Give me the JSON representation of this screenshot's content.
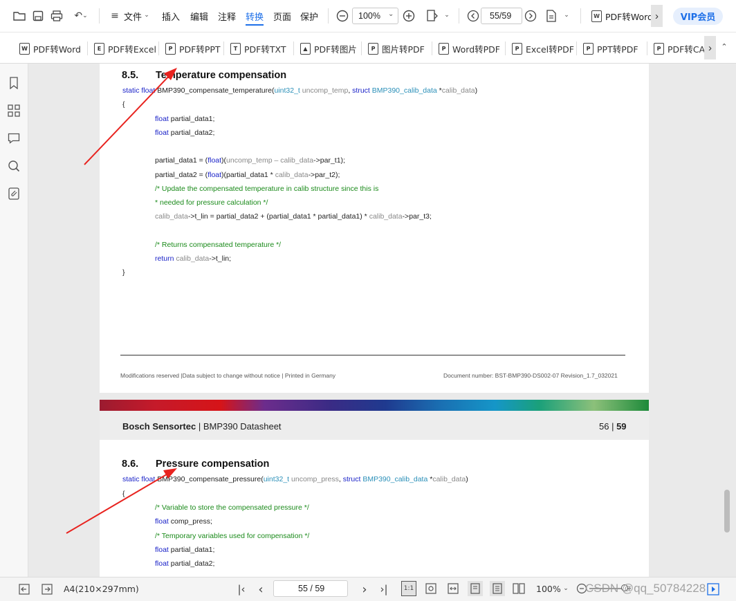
{
  "toolbar": {
    "menu": [
      "文件",
      "插入",
      "编辑",
      "注释",
      "转换",
      "页面",
      "保护"
    ],
    "active_menu": "转换",
    "zoom": "100%",
    "page_field": "55/59",
    "pdf_to_word_top": "PDF转Word",
    "vip": "VIP会员"
  },
  "convert_bar": [
    {
      "label": "PDF转Word",
      "icon": "W"
    },
    {
      "label": "PDF转Excel",
      "icon": "E"
    },
    {
      "label": "PDF转PPT",
      "icon": "P"
    },
    {
      "label": "PDF转TXT",
      "icon": "T"
    },
    {
      "label": "PDF转图片",
      "icon": "▲"
    },
    {
      "label": "图片转PDF",
      "icon": "P"
    },
    {
      "label": "Word转PDF",
      "icon": "P"
    },
    {
      "label": "Excel转PDF",
      "icon": "P"
    },
    {
      "label": "PPT转PDF",
      "icon": "P"
    },
    {
      "label": "PDF转CA",
      "icon": "P"
    }
  ],
  "page55": {
    "section_num": "8.5.",
    "section_title": "Temperature compensation",
    "code": {
      "sig_static": "static float ",
      "sig_name": "BMP390_compensate_temperature(",
      "sig_t1": "uint32_t ",
      "sig_a1": "uncomp_temp",
      "sig_c": ", ",
      "sig_struct": "struct ",
      "sig_t2": "BMP390_calib_data ",
      "sig_star": "*",
      "sig_a2": "calib_data",
      "sig_end": ")",
      "open": "{",
      "l1_kw": "float ",
      "l1": "partial_data1;",
      "l2_kw": "float ",
      "l2": "partial_data2;",
      "l3a": "partial_data1 = (",
      "l3kw": "float",
      "l3b": ")(",
      "l3g": "uncomp_temp – calib_data",
      "l3c": "->par_t1);",
      "l4a": "partial_data2 = (",
      "l4kw": "float",
      "l4b": ")(partial_data1 * ",
      "l4g": "calib_data",
      "l4c": "->par_t2);",
      "cm1": "/* Update the compensated temperature in calib structure since this is",
      "cm2": "* needed for pressure calculation */",
      "l5g": "calib_data",
      "l5a": "->t_lin = partial_data2 + (partial_data1 * partial_data1) * ",
      "l5g2": "calib_data",
      "l5b": "->par_t3;",
      "cm3": "/* Returns compensated temperature */",
      "ret_kw": "return ",
      "ret_g": "calib_data",
      "ret_b": "->t_lin;",
      "close": "}"
    },
    "footer_left": "Modifications reserved |Data subject to change without notice | Printed in Germany",
    "footer_right": "Document number: BST-BMP390-DS002-07 Revision_1.7_032021"
  },
  "page56": {
    "header_brand": "Bosch Sensortec",
    "header_sep": " | ",
    "header_doc": "BMP390 Datasheet",
    "header_page": "56",
    "header_page_sep": " | ",
    "header_total": "59",
    "section_num": "8.6.",
    "section_title": "Pressure compensation",
    "code": {
      "sig_static": "static float ",
      "sig_name": "BMP390_compensate_pressure(",
      "sig_t1": "uint32_t ",
      "sig_a1": "uncomp_press",
      "sig_c": ", ",
      "sig_struct": "struct ",
      "sig_t2": "BMP390_calib_data ",
      "sig_star": "*",
      "sig_a2": "calib_data",
      "sig_end": ")",
      "open": "{",
      "cm1": "/* Variable to store the compensated pressure */",
      "l1_kw": "float ",
      "l1": "comp_press;",
      "cm2": "/* Temporary variables used for compensation */",
      "l2_kw": "float ",
      "l2": "partial_data1;",
      "l3_kw": "float ",
      "l3": "partial_data2;"
    }
  },
  "status": {
    "paper": "A4(210×297mm)",
    "page": "55 / 59",
    "zoom": "100%",
    "watermark": "CSDN @qq_50784228"
  },
  "colors": {
    "accent": "#1d6fe8",
    "arrow": "#e8231f",
    "keyword": "#1a22c8",
    "type": "#2a8fb8",
    "comment": "#1a8a1a"
  }
}
